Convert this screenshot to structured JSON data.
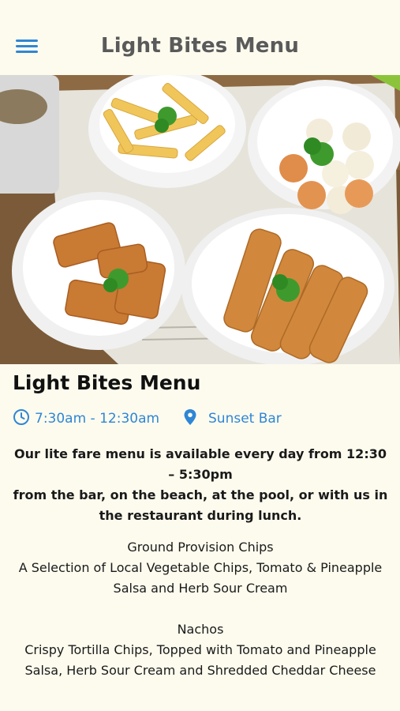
{
  "appbar": {
    "title": "Light Bites Menu",
    "menu_icon": "hamburger-menu-icon",
    "accent": "#2f86d6"
  },
  "hero": {
    "icon": "food-photo"
  },
  "section": {
    "title": "Light Bites Menu",
    "hours": "7:30am - 12:30am",
    "hours_icon": "clock-icon",
    "location": "Sunset Bar",
    "location_icon": "map-pin-icon"
  },
  "intro": {
    "line1": "Our lite fare menu is available every day from 12:30 – 5:30pm",
    "line2": "from the bar, on the beach, at the pool, or with us in the restaurant during lunch."
  },
  "items": [
    {
      "name": "Ground Provision Chips",
      "description": "A Selection of Local Vegetable Chips, Tomato & Pineapple Salsa and Herb Sour Cream"
    },
    {
      "name": "Nachos",
      "description": "Crispy Tortilla Chips, Topped with Tomato and Pineapple Salsa, Herb Sour Cream and Shredded Cheddar Cheese"
    }
  ]
}
